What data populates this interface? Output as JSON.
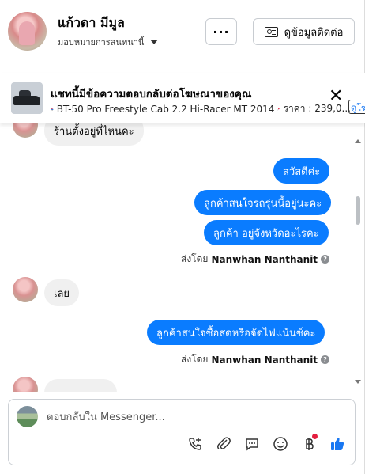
{
  "header": {
    "contact_name": "แก้วดา มีมูล",
    "assign_label": "มอบหมายการสนทนานี้",
    "more_label": "···",
    "contact_info_label": "ดูข้อมูลติดต่อ"
  },
  "ad_banner": {
    "title": "แชทนี้มีข้อความตอบกลับต่อโฆษณาของคุณ",
    "subtitle": "BT-50 Pro Freestyle Cab 2.2 Hi-Racer MT 2014",
    "price": "ราคา : 239,0...",
    "learn_more": "ดูโฆ",
    "close_label": "✕"
  },
  "messages": {
    "partial_top": "ร้านตั้งอยู่ที่ไหนคะ",
    "out_group1": [
      "สวัสดีค่ะ",
      "ลูกค้าสนใจรถรุ่นนี้อยู่นะคะ",
      "ลูกค้า อยู่จังหวัดอะไรคะ"
    ],
    "sent_by_prefix": "ส่งโดย",
    "sender_name": "Nanwhan Nanthanit",
    "in_2": "เลย",
    "out_group2": [
      "ลูกค้าสนใจซื้อสดหรือจัดไฟแน้นซ์คะ"
    ],
    "partial_bottom": "..."
  },
  "composer": {
    "placeholder": "ตอบกลับใน Messenger..."
  },
  "colors": {
    "outgoing_bubble": "#0a7cff",
    "incoming_bubble": "#f0f0f0",
    "like_icon": "#1877f2"
  }
}
